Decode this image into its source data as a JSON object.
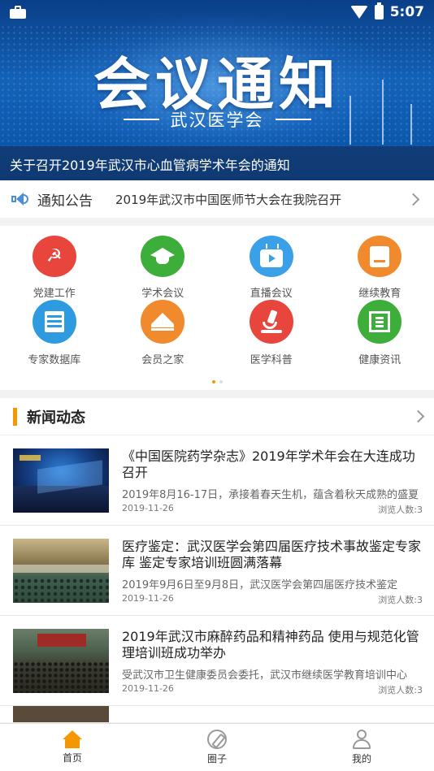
{
  "status_bar": {
    "time": "5:07"
  },
  "banner": {
    "title": "会议通知",
    "subtitle": "武汉医学会",
    "caption": "关于召开2019年武汉市心血管病学术年会的通知"
  },
  "notice": {
    "label": "通知公告",
    "text": "2019年武汉市中国医师节大会在我院召开"
  },
  "grid": {
    "items": [
      {
        "label": "党建工作",
        "icon": "party-emblem-icon",
        "color": "#e8453c"
      },
      {
        "label": "学术会议",
        "icon": "graduation-cap-icon",
        "color": "#3dae3a"
      },
      {
        "label": "直播会议",
        "icon": "tv-icon",
        "color": "#3aa0e8"
      },
      {
        "label": "继续教育",
        "icon": "book-icon",
        "color": "#f08a2c"
      },
      {
        "label": "专家数据库",
        "icon": "database-icon",
        "color": "#2e9be0"
      },
      {
        "label": "会员之家",
        "icon": "crown-icon",
        "color": "#f08a2c"
      },
      {
        "label": "医学科普",
        "icon": "microscope-icon",
        "color": "#e8453c"
      },
      {
        "label": "健康资讯",
        "icon": "newspaper-icon",
        "color": "#3dae3a"
      }
    ]
  },
  "news": {
    "title": "新闻动态",
    "items": [
      {
        "title": "《中国医院药学杂志》2019年学术年会在大连成功召开",
        "desc": "2019年8月16-17日，承接着春天生机，蕴含着秋天成熟的盛夏",
        "date": "2019-11-26",
        "views": "浏览人数:3"
      },
      {
        "title": "医疗鉴定：武汉医学会第四届医疗技术事故鉴定专家库 鉴定专家培训班圆满落幕",
        "desc": "2019年9月6日至9月8日，武汉医学会第四届医疗技术鉴定",
        "date": "2019-11-26",
        "views": "浏览人数:3"
      },
      {
        "title": "2019年武汉市麻醉药品和精神药品 使用与规范化管理培训班成功举办",
        "desc": "受武汉市卫生健康委员会委托，武汉市继续医学教育培训中心",
        "date": "2019-11-26",
        "views": "浏览人数:3"
      }
    ]
  },
  "tabbar": {
    "home": "首页",
    "circle": "圈子",
    "mine": "我的"
  },
  "colors": {
    "accent": "#f39800",
    "banner": "#0e5bb1"
  }
}
